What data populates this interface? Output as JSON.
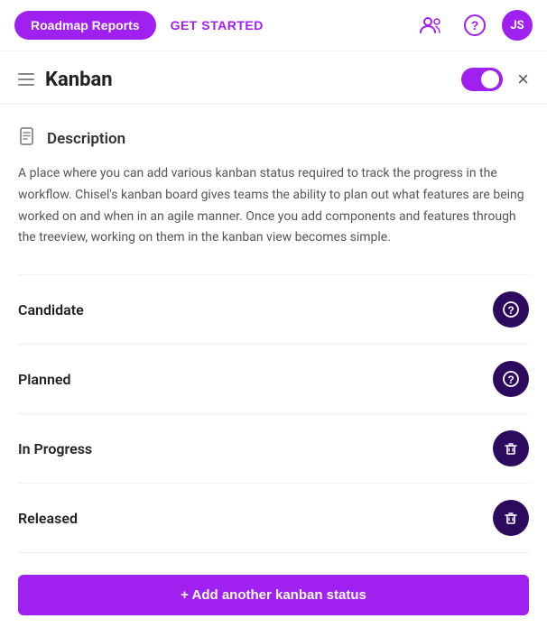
{
  "nav": {
    "primary_btn": "Roadmap Reports",
    "get_started": "GET STARTED",
    "avatar_text": "JS"
  },
  "panel": {
    "title": "Kanban",
    "close_label": "×",
    "description_title": "Description",
    "description_body": "A place where you can add various kanban status required to track the progress in the workflow. Chisel's kanban board gives teams the ability to plan out what features are being worked on and when in an agile manner. Once you add components and features through the treeview, working on them in the kanban view becomes simple.",
    "statuses": [
      {
        "label": "Candidate",
        "icon_type": "question"
      },
      {
        "label": "Planned",
        "icon_type": "question"
      },
      {
        "label": "In Progress",
        "icon_type": "trash"
      },
      {
        "label": "Released",
        "icon_type": "trash"
      }
    ],
    "add_btn": "+ Add another kanban status"
  }
}
